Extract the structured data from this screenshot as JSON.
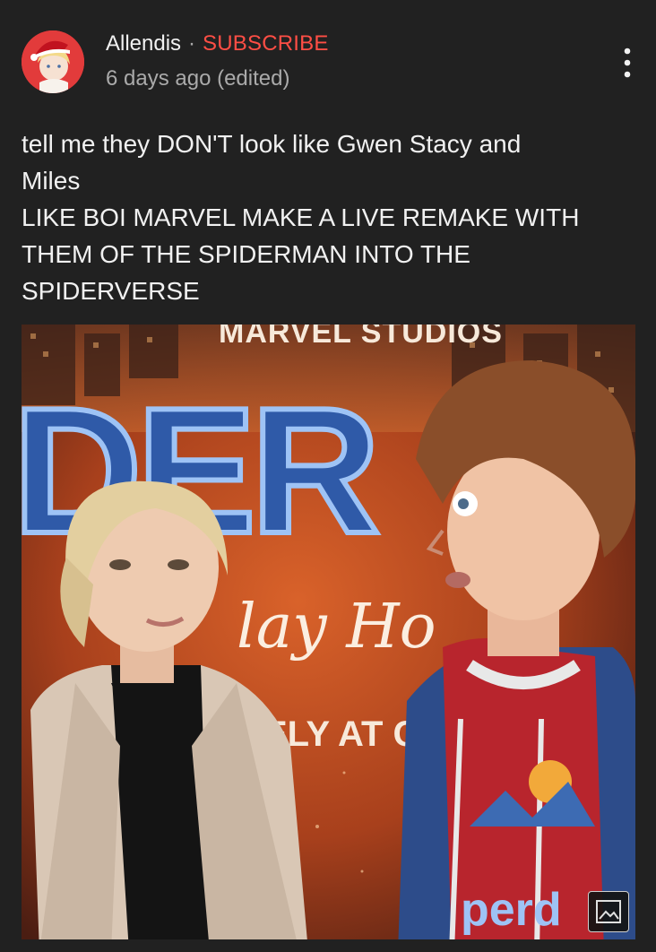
{
  "post": {
    "author": "Allendis",
    "separator": "·",
    "subscribe_label": "SUBSCRIBE",
    "timestamp": "6 days ago (edited)",
    "more_icon": "more-vert-icon",
    "text_lines": [
      "tell me they DON'T look like Gwen Stacy and",
      "Miles",
      "LIKE BOI MARVEL MAKE A LIVE REMAKE WITH",
      "THEM OF THE SPIDERMAN INTO THE",
      "SPIDERVERSE"
    ]
  },
  "image": {
    "poster_top_text": "MARVEL STUDIOS",
    "poster_title_fragment": "DER",
    "poster_script_fragment": "lay Ho",
    "poster_bottom_text": "ELY AT CI",
    "badge_icon": "image-icon"
  },
  "colors": {
    "background": "#212121",
    "subscribe": "#ff4e45",
    "secondary_text": "#aaaaaa"
  }
}
